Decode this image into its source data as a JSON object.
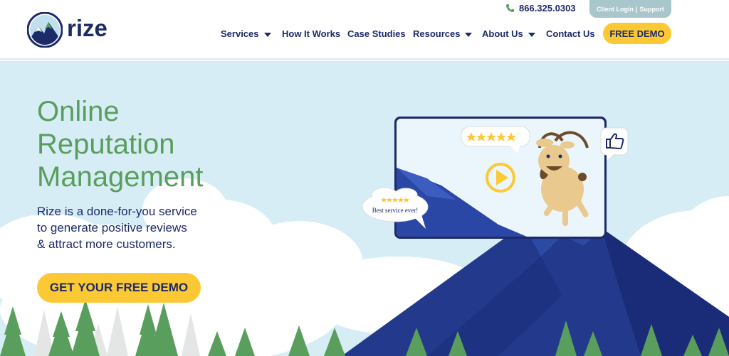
{
  "header": {
    "logo_text": "rize",
    "phone": "866.325.0303",
    "client_login": "Client Login",
    "separator": "|",
    "support": "Support",
    "cta": "FREE DEMO"
  },
  "nav": {
    "items": [
      {
        "label": "Services",
        "dropdown": true
      },
      {
        "label": "How It Works",
        "dropdown": false
      },
      {
        "label": "Case Studies",
        "dropdown": false
      },
      {
        "label": "Resources",
        "dropdown": true
      },
      {
        "label": "About Us",
        "dropdown": true
      },
      {
        "label": "Contact Us",
        "dropdown": false
      }
    ]
  },
  "hero": {
    "title_lines": [
      "Online",
      "Reputation",
      "Management"
    ],
    "subtitle_lines": [
      "Rize is a done-for-you service",
      "to generate positive reviews",
      "& attract more customers."
    ],
    "cta": "GET YOUR FREE DEMO",
    "review_bubble": "Best service ever!",
    "rating_stars": 5
  },
  "colors": {
    "navy": "#1c2a69",
    "green": "#5a9e5d",
    "yellow": "#fcc934",
    "sky": "#d7edf6",
    "client_login_bg": "#a8c6cc"
  },
  "icons": [
    "logo-mountain-icon",
    "phone-icon",
    "chevron-down-icon",
    "play-icon",
    "thumbs-up-icon",
    "star-icon",
    "goat-illustration"
  ]
}
